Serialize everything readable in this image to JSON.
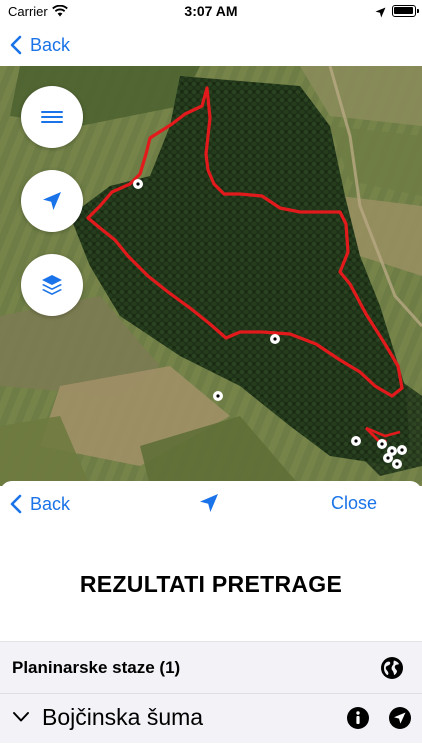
{
  "status_bar": {
    "carrier": "Carrier",
    "time": "3:07 AM"
  },
  "nav": {
    "back_label": "Back"
  },
  "map": {
    "buttons": [
      {
        "name": "menu",
        "icon": "hamburger-menu-icon"
      },
      {
        "name": "locate",
        "icon": "location-arrow-icon"
      },
      {
        "name": "layers",
        "icon": "layers-icon"
      }
    ],
    "route_color": "#e31a1c"
  },
  "sheet": {
    "back_label": "Back",
    "close_label": "Close",
    "title": "REZULTATI PRETRAGE",
    "section_label": "Planinarske staze (1)",
    "items": [
      {
        "label": "Bojčinska šuma"
      }
    ]
  },
  "colors": {
    "accent": "#1a73e8",
    "section_bg": "#f2f2f7"
  }
}
